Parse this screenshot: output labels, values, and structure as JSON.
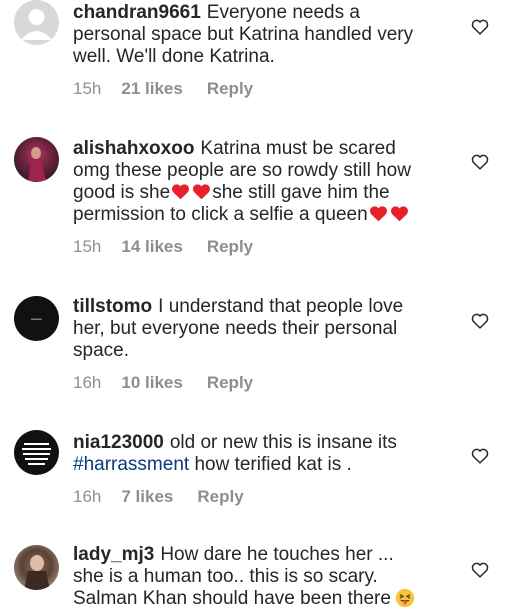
{
  "comments": [
    {
      "username": "chandran9661",
      "text_lines": [
        "Everyone needs a",
        "personal space but Katrina handled very",
        "well. We'll done Katrina."
      ],
      "time": "15h",
      "likes": "21 likes",
      "reply": "Reply",
      "avatar": "default-avatar"
    },
    {
      "username": "alishahxoxoo",
      "text_parts": {
        "a": "Katrina must be scared",
        "b": "omg these people are so rowdy still how",
        "c": "good is she",
        "d": "she still gave him the",
        "e": "permission to click a selfie a queen"
      },
      "time": "15h",
      "likes": "14 likes",
      "reply": "Reply",
      "avatar": "photo-avatar"
    },
    {
      "username": "tillstomo",
      "text_lines": [
        "I understand that people love",
        "her, but everyone needs their personal",
        "space."
      ],
      "time": "16h",
      "likes": "10 likes",
      "reply": "Reply",
      "avatar": "dark-avatar"
    },
    {
      "username": "nia123000",
      "text_a": "old or new this is insane its",
      "hashtag": "#harrassment",
      "text_b": " how terified kat is .",
      "time": "16h",
      "likes": "7 likes",
      "reply": "Reply",
      "avatar": "quote-avatar"
    },
    {
      "username": "lady_mj3",
      "text_lines": [
        "How dare he touches her ...",
        "she is a human too.. this is so scary.",
        "Salman Khan should have been there"
      ],
      "avatar": "photo-avatar"
    }
  ],
  "icons": {
    "like": "heart-outline-icon",
    "emoji_heart": "red-heart-emoji",
    "emoji_face": "squinting-tongue-emoji"
  },
  "colors": {
    "text": "#262626",
    "meta": "#8e8e8e",
    "hashtag": "#0a3a7a",
    "heart_emoji": "#e8202a"
  }
}
